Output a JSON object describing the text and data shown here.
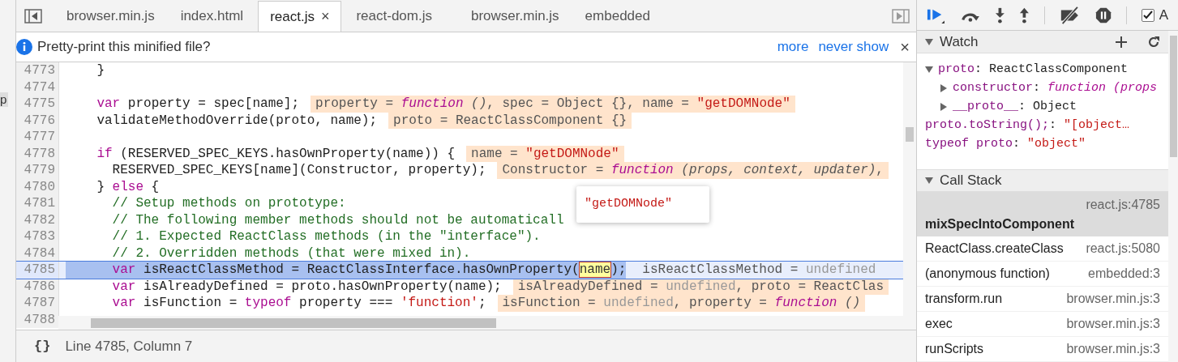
{
  "editor_tabs": [
    {
      "label": "browser.min.js",
      "selected": false
    },
    {
      "label": "index.html",
      "selected": false
    },
    {
      "label": "react.js",
      "selected": true,
      "close": "×"
    },
    {
      "label": "react-dom.js",
      "selected": false
    },
    {
      "label": "browser.min.js",
      "selected": false
    },
    {
      "label": "embedded",
      "selected": false
    }
  ],
  "left_fragment": "p",
  "infobar": {
    "message": "Pretty-print this minified file?",
    "links": [
      "more",
      "never show"
    ],
    "close": "×"
  },
  "code_lines": [
    {
      "number": "4773",
      "selected": false,
      "tokens": [
        {
          "kind": "text",
          "text": "    }"
        }
      ]
    },
    {
      "number": "4774",
      "selected": false
    },
    {
      "number": "4775",
      "selected": false,
      "tokens": [
        {
          "kind": "keyword",
          "text": "    var"
        },
        {
          "kind": "text",
          "text": " property = spec[name];"
        }
      ],
      "annotation": [
        {
          "kind": "text",
          "text": "property = "
        },
        {
          "kind": "fn",
          "text": "function"
        },
        {
          "kind": "italic",
          "text": " ()"
        },
        {
          "kind": "text",
          "text": ", spec = Object {}, name = "
        },
        {
          "kind": "string",
          "text": "\"getDOMNode\""
        }
      ]
    },
    {
      "number": "4776",
      "selected": false,
      "tokens": [
        {
          "kind": "text",
          "text": "    validateMethodOverride(proto, name);"
        }
      ],
      "annotation": [
        {
          "kind": "text",
          "text": "proto = ReactClassComponent {}"
        }
      ]
    },
    {
      "number": "4777",
      "selected": false
    },
    {
      "number": "4778",
      "selected": false,
      "tokens": [
        {
          "kind": "keyword",
          "text": "    if"
        },
        {
          "kind": "text",
          "text": " (RESERVED_SPEC_KEYS.hasOwnProperty(name)) {"
        }
      ],
      "annotation": [
        {
          "kind": "text",
          "text": "name = "
        },
        {
          "kind": "string",
          "text": "\"getDOMNode\""
        }
      ]
    },
    {
      "number": "4779",
      "selected": false,
      "tokens": [
        {
          "kind": "text",
          "text": "      RESERVED_SPEC_KEYS[name](Constructor, property);"
        }
      ],
      "annotation": [
        {
          "kind": "text",
          "text": "Constructor = "
        },
        {
          "kind": "fn",
          "text": "function"
        },
        {
          "kind": "italic",
          "text": " (props, context, updater)"
        },
        {
          "kind": "text",
          "text": ","
        }
      ]
    },
    {
      "number": "4780",
      "selected": false,
      "tokens": [
        {
          "kind": "text",
          "text": "    } "
        },
        {
          "kind": "keyword",
          "text": "else"
        },
        {
          "kind": "text",
          "text": " {"
        }
      ]
    },
    {
      "number": "4781",
      "selected": false,
      "tokens": [
        {
          "kind": "comment",
          "text": "      // Setup methods on prototype:"
        }
      ]
    },
    {
      "number": "4782",
      "selected": false,
      "tokens": [
        {
          "kind": "comment",
          "text": "      // The following member methods should not be automaticall"
        }
      ]
    },
    {
      "number": "4783",
      "selected": false,
      "tokens": [
        {
          "kind": "comment",
          "text": "      // 1. Expected ReactClass methods (in the \"interface\")."
        }
      ]
    },
    {
      "number": "4784",
      "selected": false,
      "tokens": [
        {
          "kind": "comment",
          "text": "      // 2. Overridden methods (that were mixed in)."
        }
      ]
    },
    {
      "number": "4785",
      "selected": true,
      "tokens": [
        {
          "kind": "keyword",
          "text": "      var"
        },
        {
          "kind": "text",
          "text": " isReactClassMethod = ReactClassInterface.hasOwnProperty("
        },
        {
          "kind": "match",
          "text": "name"
        },
        {
          "kind": "text",
          "text": ");"
        }
      ],
      "annotation": [
        {
          "kind": "text",
          "text": "isReactClassMethod = "
        },
        {
          "kind": "undef",
          "text": "undefined"
        }
      ]
    },
    {
      "number": "4786",
      "selected": false,
      "tokens": [
        {
          "kind": "keyword",
          "text": "      var"
        },
        {
          "kind": "text",
          "text": " isAlreadyDefined = proto.hasOwnProperty(name);"
        }
      ],
      "annotation": [
        {
          "kind": "text",
          "text": "isAlreadyDefined = "
        },
        {
          "kind": "undef",
          "text": "undefined"
        },
        {
          "kind": "text",
          "text": ", proto = ReactClas"
        }
      ]
    },
    {
      "number": "4787",
      "selected": false,
      "tokens": [
        {
          "kind": "keyword",
          "text": "      var"
        },
        {
          "kind": "text",
          "text": " isFunction = "
        },
        {
          "kind": "keyword",
          "text": "typeof"
        },
        {
          "kind": "text",
          "text": " property === "
        },
        {
          "kind": "string",
          "text": "'function'"
        },
        {
          "kind": "text",
          "text": ";"
        }
      ],
      "annotation": [
        {
          "kind": "text",
          "text": "isFunction = "
        },
        {
          "kind": "undef",
          "text": "undefined"
        },
        {
          "kind": "text",
          "text": ", property = "
        },
        {
          "kind": "fn",
          "text": "function"
        },
        {
          "kind": "italic",
          "text": " ()"
        }
      ]
    },
    {
      "number": "4788",
      "selected": false
    }
  ],
  "popover": {
    "value": "\"getDOMNode\""
  },
  "status_bar": {
    "icon_text": "{}",
    "position": "Line 4785, Column 7"
  },
  "debugger_toolbar": {
    "async_checked": true,
    "async_label": "A"
  },
  "watch": {
    "title": "Watch",
    "expanded": true,
    "items": [
      {
        "name": "proto",
        "separator": ":",
        "value": "ReactClassComponent",
        "kind": "plain",
        "expanded": true,
        "children": [
          {
            "name": "constructor",
            "separator": ":",
            "value": "function (props",
            "kind": "fn",
            "expanded": false
          },
          {
            "name": "__proto__",
            "separator": ":",
            "value": "Object",
            "kind": "plain",
            "expanded": false
          }
        ]
      },
      {
        "name": "proto.toString();",
        "separator": ":",
        "value": "\"[object…",
        "kind": "string"
      },
      {
        "name": "typeof proto",
        "separator": ":",
        "value": "\"object\"",
        "kind": "string"
      }
    ]
  },
  "call_stack": {
    "title": "Call Stack",
    "expanded": true,
    "frames": [
      {
        "function": "mixSpecIntoComponent",
        "location": "react.js:4785",
        "selected": true
      },
      {
        "function": "ReactClass.createClass",
        "location": "react.js:5080",
        "selected": false
      },
      {
        "function": "(anonymous function)",
        "location": "embedded:3",
        "selected": false
      },
      {
        "function": "transform.run",
        "location": "browser.min.js:3",
        "selected": false
      },
      {
        "function": "exec",
        "location": "browser.min.js:3",
        "selected": false
      },
      {
        "function": "runScripts",
        "location": "browser.min.js:3",
        "selected": false
      }
    ]
  }
}
